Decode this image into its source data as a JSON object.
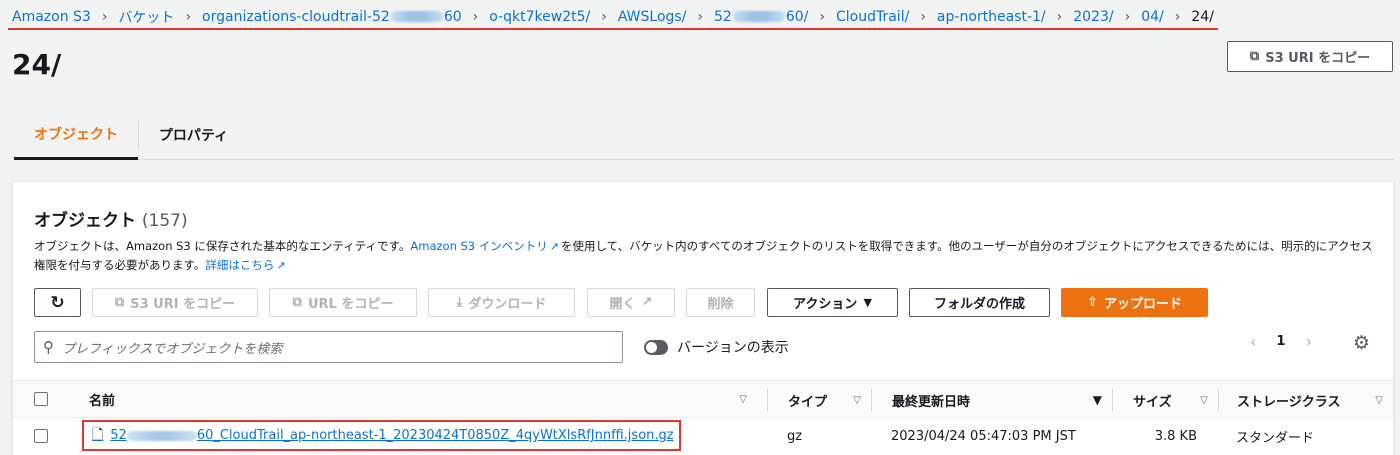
{
  "breadcrumb": {
    "items": [
      "Amazon S3",
      "バケット",
      "organizations-cloudtrail-52",
      "60",
      "o-qkt7kew2t5/",
      "AWSLogs/",
      "52",
      "60/",
      "CloudTrail/",
      "ap-northeast-1/",
      "2023/",
      "04/",
      "24/"
    ]
  },
  "page": {
    "title": "24/",
    "copy_s3_uri": "S3 URI をコピー"
  },
  "tabs": [
    "オブジェクト",
    "プロパティ"
  ],
  "objects": {
    "heading": "オブジェクト",
    "count": "(157)",
    "desc_1": "オブジェクトは、Amazon S3 に保存された基本的なエンティティです。",
    "desc_link_1": "Amazon S3 インベントリ",
    "desc_2": "を使用して、バケット内のすべてのオブジェクトのリストを取得できます。他のユーザーが自分のオブジェクトにアクセスできるためには、明示的にアクセス権限を付与する必要があります。",
    "desc_link_2": "詳細はこちら",
    "toolbar": {
      "copy_s3_uri": "S3 URI をコピー",
      "copy_url": "URL をコピー",
      "download": "ダウンロード",
      "open": "開く",
      "delete": "削除",
      "actions": "アクション",
      "create_folder": "フォルダの作成",
      "upload": "アップロード"
    },
    "search_placeholder": "プレフィックスでオブジェクトを検索",
    "version_toggle": "バージョンの表示",
    "page_number": "1",
    "columns": [
      "名前",
      "タイプ",
      "最終更新日時",
      "サイズ",
      "ストレージクラス"
    ],
    "rows": [
      {
        "name_prefix": "52",
        "name_suffix": "60_CloudTrail_ap-northeast-1_20230424T0850Z_4qyWtXlsRfJnnffi.json.gz",
        "type": "gz",
        "modified": "2023/04/24 05:47:03 PM JST",
        "size": "3.8 KB",
        "storage_class": "スタンダード"
      }
    ]
  },
  "colors": {
    "link": "#0972d3",
    "accent": "#ec7211",
    "highlight": "#e8352b"
  }
}
